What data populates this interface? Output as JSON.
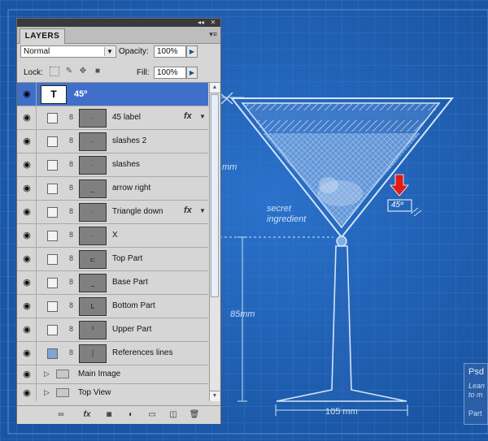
{
  "panel": {
    "tab_label": "LAYERS",
    "collapse_glyph": "◂◂",
    "close_glyph": "✕",
    "menu_glyph": "▾≡",
    "blend_mode": "Normal",
    "opacity_label": "Opacity:",
    "opacity_value": "100%",
    "lock_label": "Lock:",
    "fill_label": "Fill:",
    "fill_value": "100%"
  },
  "layers": [
    {
      "name": "45º",
      "type": "text",
      "thumb": "T",
      "selected": true
    },
    {
      "name": "45 label",
      "type": "shape",
      "fx": true
    },
    {
      "name": "slashes 2",
      "type": "shape"
    },
    {
      "name": "slashes",
      "type": "shape"
    },
    {
      "name": "arrow right",
      "type": "shape"
    },
    {
      "name": "Triangle down",
      "type": "shape",
      "fx": true
    },
    {
      "name": "X",
      "type": "shape"
    },
    {
      "name": "Top Part",
      "type": "shape"
    },
    {
      "name": "Base Part",
      "type": "shape"
    },
    {
      "name": "Bottom Part",
      "type": "shape"
    },
    {
      "name": "Upper Part",
      "type": "shape"
    },
    {
      "name": "References lines",
      "type": "shape",
      "filled_mask": true
    }
  ],
  "groups": [
    {
      "name": "Main Image"
    },
    {
      "name": "Top View"
    }
  ],
  "fx_label": "fx",
  "canvas": {
    "dim_left_partial": "mm",
    "dim_85": "85mm",
    "dim_105": "105 mm",
    "secret_line1": "secret",
    "secret_line2": "ingredient",
    "angle_label": "45º",
    "side_card_title": "Psd",
    "side_card_line1": "Lean",
    "side_card_line2": "to m",
    "side_card_line3": "Part",
    "colors": {
      "background": "#1f5fb0",
      "line": "#cfe0f5",
      "arrow": "#e11a1a"
    }
  }
}
